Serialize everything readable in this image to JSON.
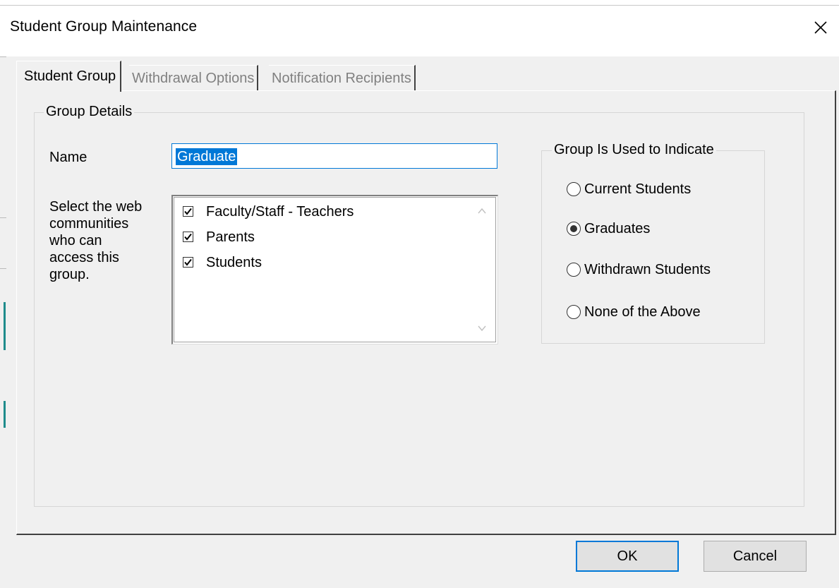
{
  "window": {
    "title": "Student Group Maintenance"
  },
  "tabs": [
    {
      "label": "Student Group",
      "active": true
    },
    {
      "label": "Withdrawal Options",
      "active": false
    },
    {
      "label": "Notification Recipients",
      "active": false
    }
  ],
  "group_details": {
    "legend": "Group Details",
    "name_label": "Name",
    "name_value": "Graduate",
    "communities_label_lines": [
      "Select the web",
      "communities",
      "who can",
      "access this",
      "group."
    ],
    "communities": [
      {
        "label": "Faculty/Staff - Teachers",
        "checked": true
      },
      {
        "label": "Parents",
        "checked": true
      },
      {
        "label": "Students",
        "checked": true
      }
    ]
  },
  "usage": {
    "legend": "Group Is Used to Indicate",
    "options": [
      {
        "label": "Current Students",
        "selected": false
      },
      {
        "label": "Graduates",
        "selected": true
      },
      {
        "label": "Withdrawn Students",
        "selected": false
      },
      {
        "label": "None of the Above",
        "selected": false
      }
    ]
  },
  "buttons": {
    "ok": "OK",
    "cancel": "Cancel"
  },
  "colors": {
    "focus": "#0078d7",
    "selection": "#0078d7",
    "accent": "#1f8c8c"
  }
}
